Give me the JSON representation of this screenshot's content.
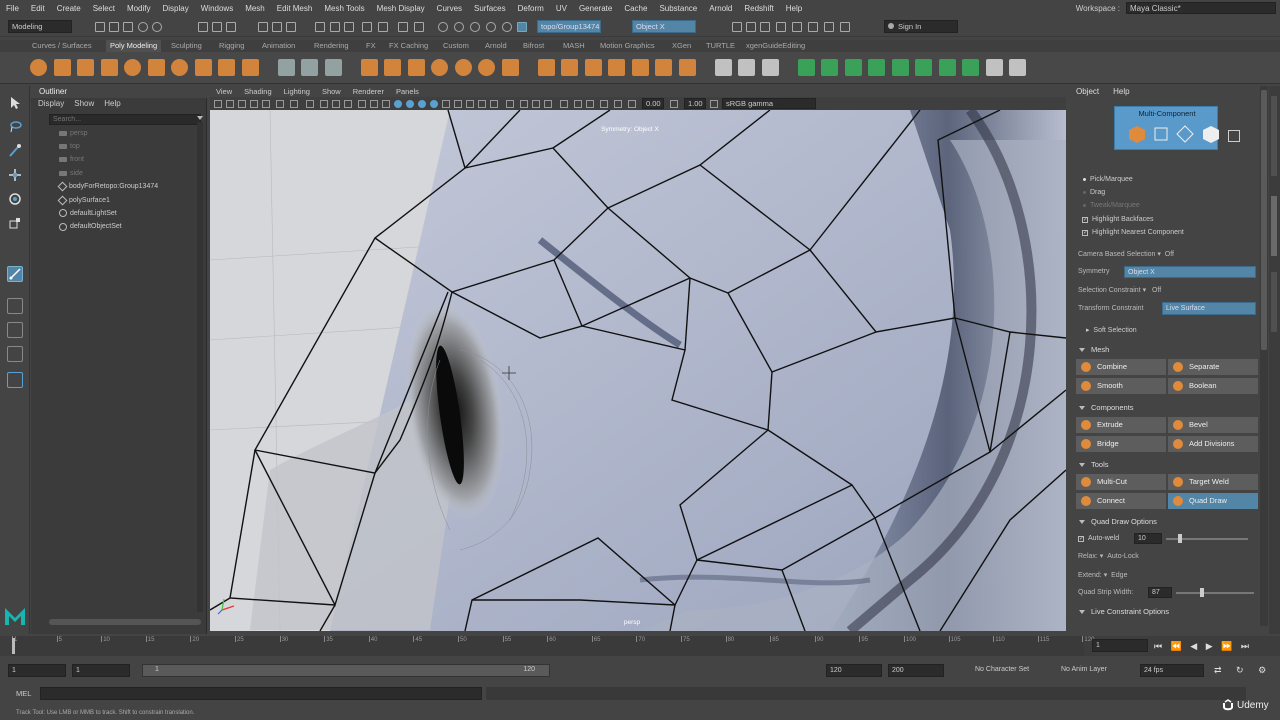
{
  "menu": [
    "File",
    "Edit",
    "Create",
    "Select",
    "Modify",
    "Display",
    "Windows",
    "Mesh",
    "Edit Mesh",
    "Mesh Tools",
    "Mesh Display",
    "Curves",
    "Surfaces",
    "Deform",
    "UV",
    "Generate",
    "Cache",
    "Substance",
    "Arnold",
    "Redshift",
    "Help"
  ],
  "workspace": {
    "label": "Workspace :",
    "value": "Maya Classic*"
  },
  "statusline": {
    "mode": "Modeling",
    "object_field": "topo/Group13474",
    "symmetry_field": "Object X",
    "sign_in": "Sign In"
  },
  "shelf_tabs": [
    "Curves / Surfaces",
    "Poly Modeling",
    "Sculpting",
    "Rigging",
    "Animation",
    "Rendering",
    "FX",
    "FX Caching",
    "Custom",
    "Arnold",
    "Bifrost",
    "MASH",
    "Motion Graphics",
    "XGen",
    "TURTLE",
    "xgenGuideEditing"
  ],
  "shelf_active": "Poly Modeling",
  "outliner": {
    "title": "Outliner",
    "menu": [
      "Display",
      "Show",
      "Help"
    ],
    "search_placeholder": "Search...",
    "items": [
      {
        "label": "persp",
        "type": "cam",
        "dim": true
      },
      {
        "label": "top",
        "type": "cam",
        "dim": true
      },
      {
        "label": "front",
        "type": "cam",
        "dim": true
      },
      {
        "label": "side",
        "type": "cam",
        "dim": true
      },
      {
        "label": "bodyForRetopo:Group13474",
        "type": "msh",
        "dim": false
      },
      {
        "label": "polySurface1",
        "type": "msh",
        "dim": false
      },
      {
        "label": "defaultLightSet",
        "type": "set",
        "dim": false
      },
      {
        "label": "defaultObjectSet",
        "type": "set",
        "dim": false
      }
    ]
  },
  "viewport": {
    "menu": [
      "View",
      "Shading",
      "Lighting",
      "Show",
      "Renderer",
      "Panels"
    ],
    "exposure": "0.00",
    "gamma": "1.00",
    "color_space": "sRGB gamma",
    "symmetry_label": "Symmetry: Object X",
    "camera_label": "persp"
  },
  "modeling_toolkit": {
    "menu": [
      "Object",
      "Help"
    ],
    "mode_title": "Multi-Component",
    "pick_options": [
      {
        "label": "Pick/Marquee",
        "dim": false
      },
      {
        "label": "Drag",
        "dim": false
      },
      {
        "label": "Tweak/Marquee",
        "dim": true
      }
    ],
    "checks": [
      "Highlight Backfaces",
      "Highlight Nearest Component"
    ],
    "camera_based_selection": {
      "label": "Camera Based Selection",
      "value": "Off"
    },
    "symmetry": {
      "label": "Symmetry",
      "value": "Object X"
    },
    "selection_constraint": {
      "label": "Selection Constraint",
      "value": "Off"
    },
    "transform_constraint": {
      "label": "Transform Constraint",
      "value": "Live Surface"
    },
    "soft_selection": "Soft Selection",
    "sections": {
      "mesh": {
        "title": "Mesh",
        "buttons": [
          "Combine",
          "Separate",
          "Smooth",
          "Boolean"
        ]
      },
      "components": {
        "title": "Components",
        "buttons": [
          "Extrude",
          "Bevel",
          "Bridge",
          "Add Divisions"
        ]
      },
      "tools": {
        "title": "Tools",
        "buttons": [
          "Multi-Cut",
          "Target Weld",
          "Connect",
          "Quad Draw"
        ]
      }
    },
    "quad_draw": {
      "title": "Quad Draw Options",
      "auto_weld_label": "Auto-weld",
      "auto_weld_value": "10",
      "relax_label": "Relax:",
      "relax_value": "Auto-Lock",
      "extend_label": "Extend:",
      "extend_value": "Edge",
      "strip_label": "Quad Strip Width:",
      "strip_value": "87"
    },
    "live_constraint": "Live Constraint Options"
  },
  "timeline": {
    "ticks": [
      "1",
      "5",
      "10",
      "15",
      "20",
      "25",
      "30",
      "35",
      "40",
      "45",
      "50",
      "55",
      "60",
      "65",
      "70",
      "75",
      "80",
      "85",
      "90",
      "95",
      "100",
      "105",
      "110",
      "115",
      "120"
    ],
    "current_frame": "1"
  },
  "range": {
    "start": "1",
    "anim_start": "1",
    "slider_start": "1",
    "slider_end": "120",
    "anim_end": "120",
    "end": "200",
    "character_set": "No Character Set",
    "anim_layer": "No Anim Layer",
    "fps": "24 fps"
  },
  "command_line": {
    "lang": "MEL"
  },
  "help_line": "Track Tool: Use LMB or MMB to track. Shift to constrain translation.",
  "watermark": "Udemy",
  "colors": {
    "accent_blue": "#5285a6",
    "mode_blue": "#5a9acb",
    "tool_orange": "#e08a3c"
  }
}
